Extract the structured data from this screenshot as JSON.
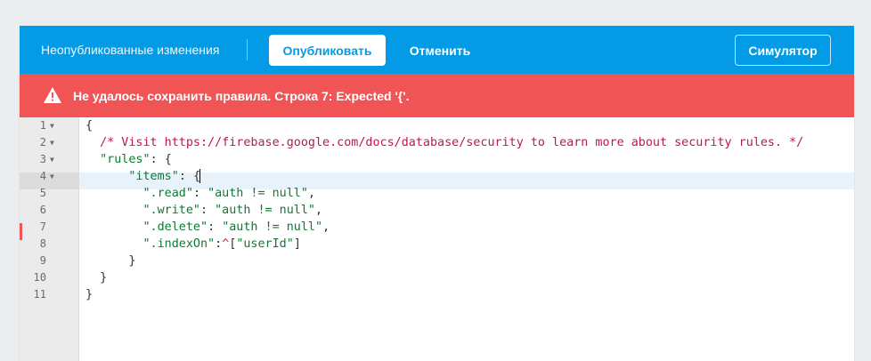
{
  "toolbar": {
    "unpublished_label": "Неопубликованные изменения",
    "publish_label": "Опубликовать",
    "cancel_label": "Отменить",
    "simulator_label": "Симулятор"
  },
  "error": {
    "icon": "warning-icon",
    "message": "Не удалось сохранить правила. Строка 7: Expected '{'."
  },
  "editor": {
    "active_line": 4,
    "error_line": 7,
    "lines": [
      {
        "num": "1",
        "fold": "▼",
        "code": "{"
      },
      {
        "num": "2",
        "fold": "▼",
        "code": "  /* Visit https://firebase.google.com/docs/database/security to learn more about security rules. */"
      },
      {
        "num": "3",
        "fold": "▼",
        "code": "  \"rules\": {"
      },
      {
        "num": "4",
        "fold": "▼",
        "code": "      \"items\": {"
      },
      {
        "num": "5",
        "fold": "",
        "code": "        \".read\": \"auth != null\","
      },
      {
        "num": "6",
        "fold": "",
        "code": "        \".write\": \"auth != null\","
      },
      {
        "num": "7",
        "fold": "",
        "code": "        \".delete\": \"auth != null\","
      },
      {
        "num": "8",
        "fold": "",
        "code": "        \".indexOn\":^[\"userId\"]"
      },
      {
        "num": "9",
        "fold": "",
        "code": "      }"
      },
      {
        "num": "10",
        "fold": "",
        "code": "  }"
      },
      {
        "num": "11",
        "fold": "",
        "code": "}"
      }
    ]
  },
  "colors": {
    "toolbar": "#039be5",
    "error_bar": "#f05454",
    "comment": "#c0145a",
    "string": "#0e7a32"
  }
}
